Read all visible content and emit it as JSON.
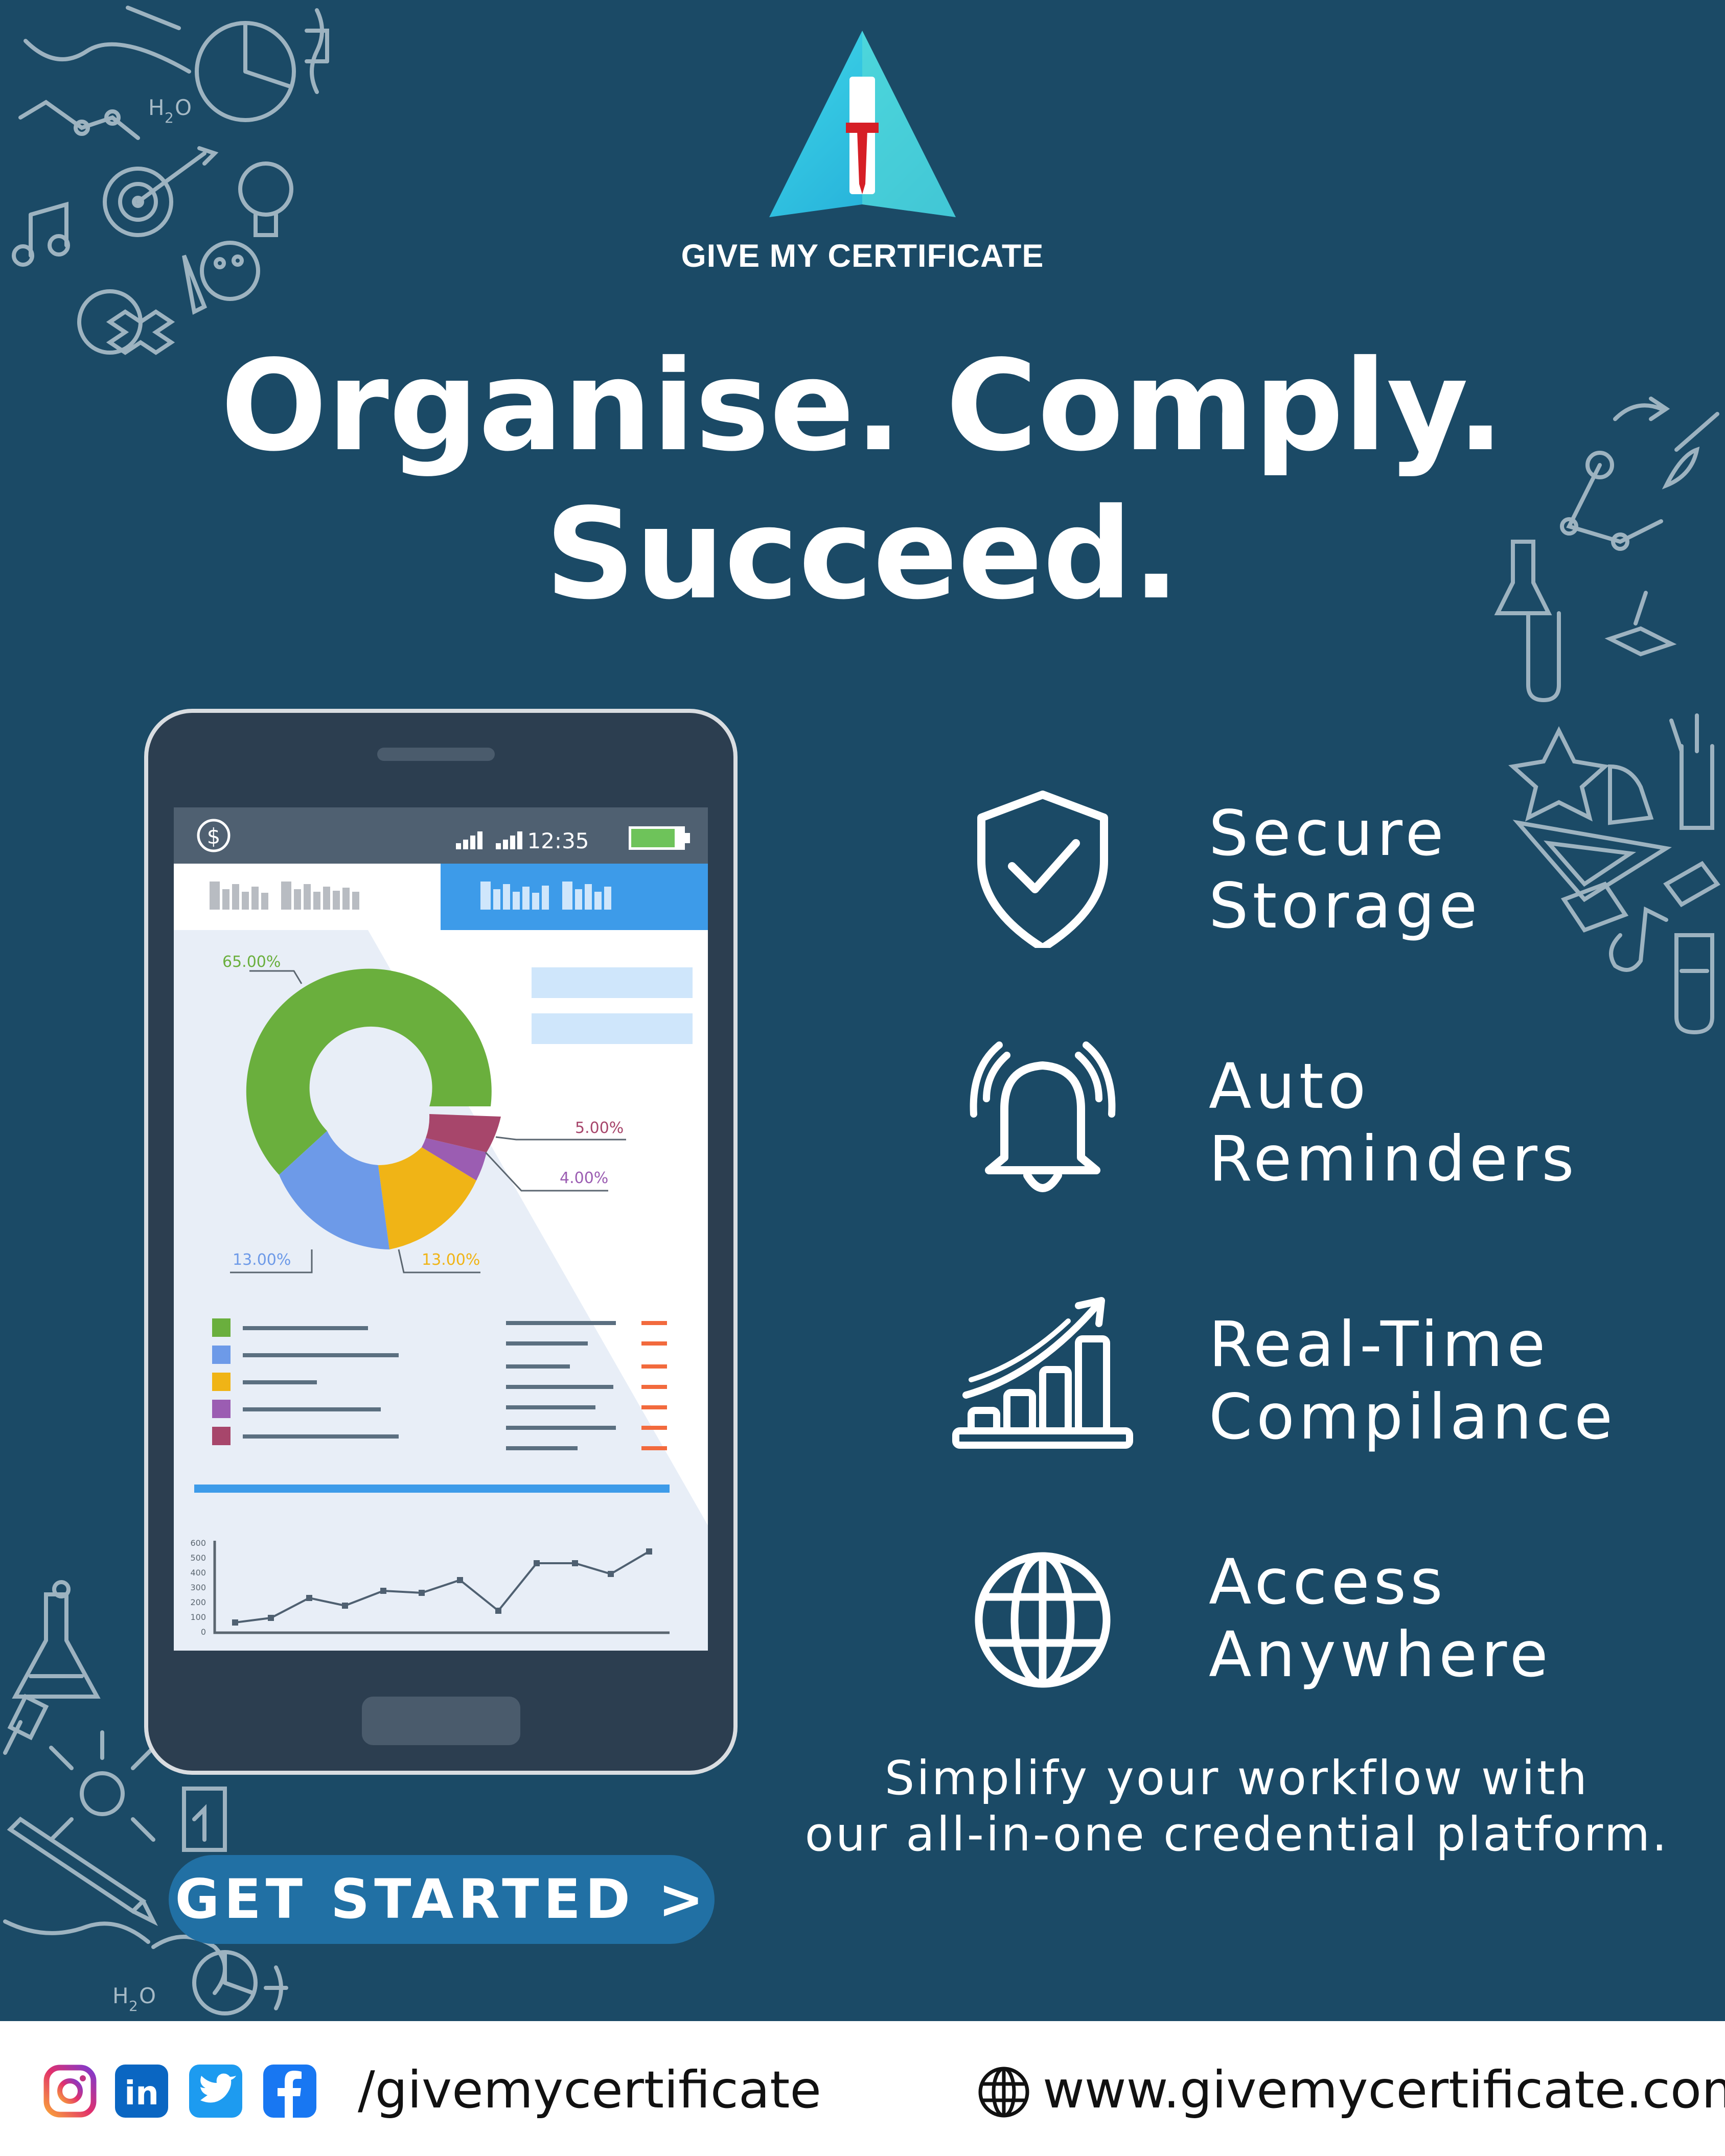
{
  "brand": {
    "name": "GIVE MY CERTIFICATE"
  },
  "headline": {
    "line1": "Organise. Comply.",
    "line2": "Succeed."
  },
  "phone": {
    "status_time": "12:35",
    "donut_labels": [
      "65.00%",
      "5.00%",
      "4.00%",
      "13.00%",
      "13.00%"
    ],
    "line_chart_ticks": [
      "600",
      "500",
      "400",
      "300",
      "200",
      "100",
      "0"
    ]
  },
  "features": [
    {
      "line1": "Secure",
      "line2": "Storage",
      "icon": "shield-check-icon"
    },
    {
      "line1": "Auto",
      "line2": "Reminders",
      "icon": "bell-icon"
    },
    {
      "line1": "Real-Time",
      "line2": "Compilance",
      "icon": "growth-chart-icon"
    },
    {
      "line1": "Access",
      "line2": "Anywhere",
      "icon": "globe-icon"
    }
  ],
  "tagline": {
    "line1": "Simplify your workflow with",
    "line2": "our all-in-one credential platform."
  },
  "cta": {
    "label": "GET STARTED >"
  },
  "footer": {
    "handle": "/givemycertificate",
    "website": "www.givemycertificate.com"
  },
  "colors": {
    "background": "#1b4a66",
    "cta": "#2170a4",
    "footer": "#ffffff",
    "donut_green": "#6aaf3d",
    "donut_blue": "#6d9ae8",
    "donut_yellow": "#f0b416",
    "donut_purple": "#9b5db2",
    "donut_maroon": "#a7466b"
  }
}
